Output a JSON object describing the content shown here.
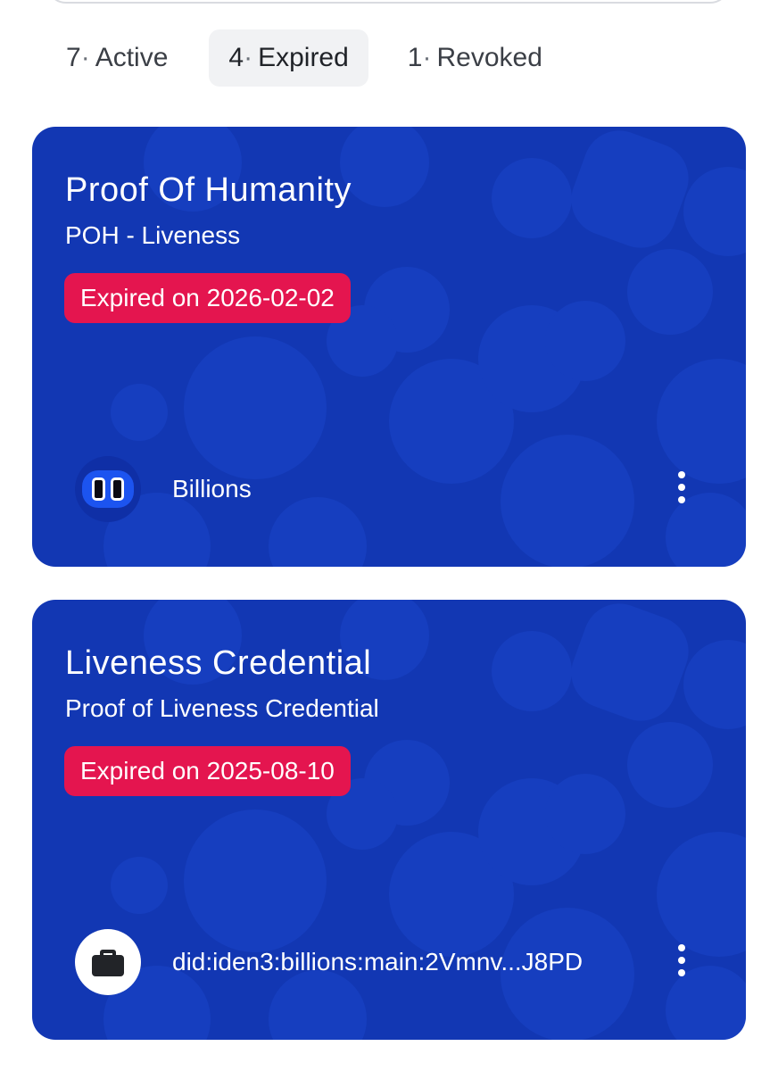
{
  "tabs": [
    {
      "count": "7",
      "label": "Active"
    },
    {
      "count": "4",
      "label": "Expired"
    },
    {
      "count": "1",
      "label": "Revoked"
    }
  ],
  "selected_tab": "Expired",
  "credentials": [
    {
      "title": "Proof Of Humanity",
      "subtitle": "POH - Liveness",
      "status": "Expired on 2026-02-02",
      "issuer": "Billions",
      "issuer_icon": "billions-logo-icon"
    },
    {
      "title": "Liveness Credential",
      "subtitle": "Proof of Liveness Credential",
      "status": "Expired on 2025-08-10",
      "issuer": "did:iden3:billions:main:2Vmnv...J8PD",
      "issuer_icon": "briefcase-icon"
    }
  ],
  "colors": {
    "card_background": "#1237b3",
    "badge_background": "#e4154f",
    "selected_tab_background": "#f1f2f4"
  }
}
